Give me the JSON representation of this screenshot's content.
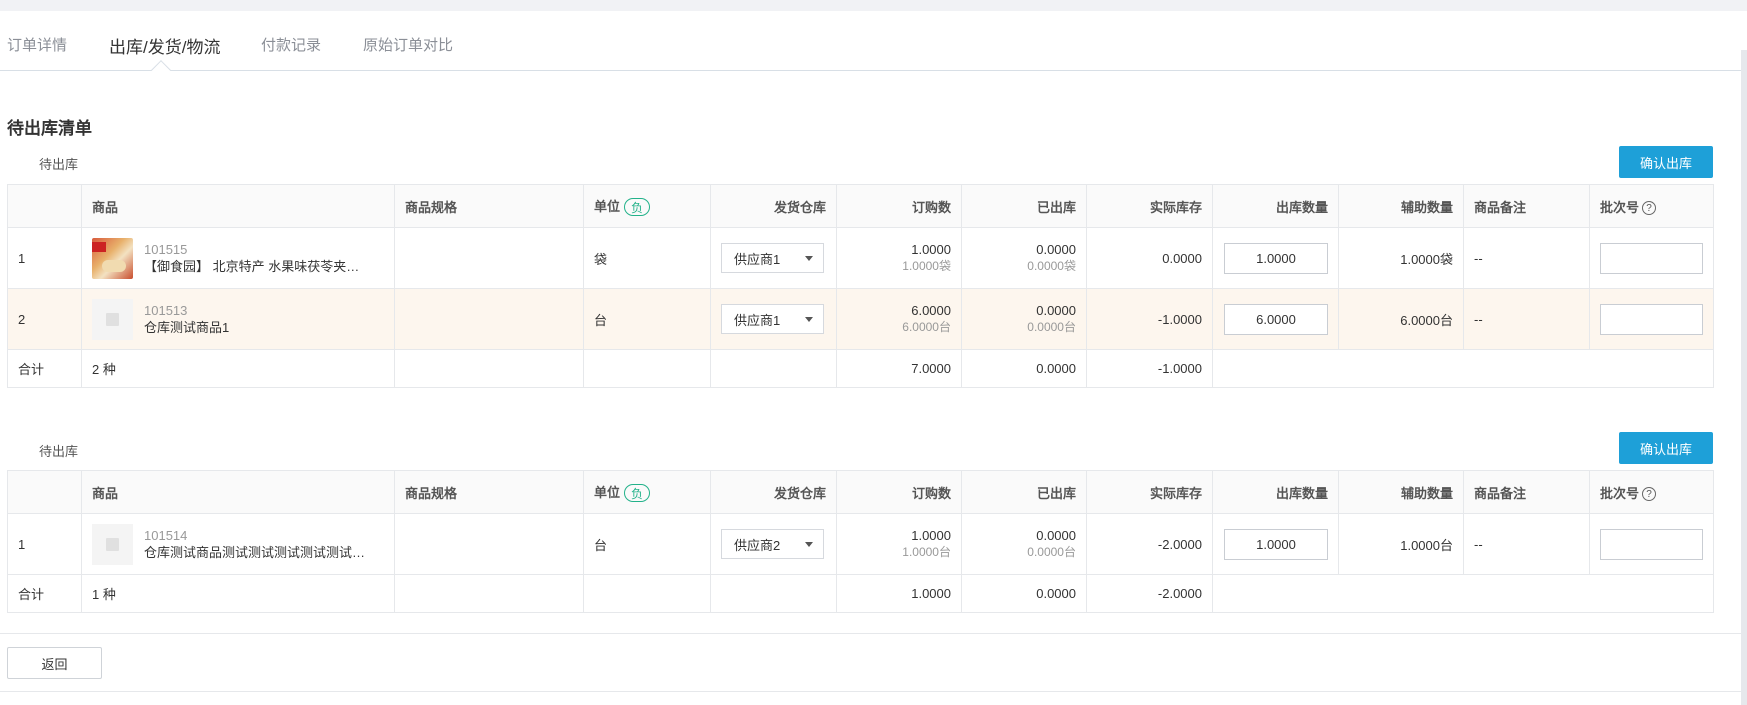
{
  "tabs": [
    {
      "label": "订单详情"
    },
    {
      "label": "出库/发货/物流"
    },
    {
      "label": "付款记录"
    },
    {
      "label": "原始订单对比"
    }
  ],
  "section_title": "待出库清单",
  "blocks": [
    {
      "label": "待出库",
      "confirm_label": "确认出库",
      "headers": {
        "product": "商品",
        "spec": "商品规格",
        "unit": "单位",
        "unit_badge": "负",
        "warehouse": "发货仓库",
        "ordered": "订购数",
        "shipped": "已出库",
        "stock": "实际库存",
        "out_qty": "出库数量",
        "aux_qty": "辅助数量",
        "remark": "商品备注",
        "batch": "批次号",
        "batch_help": "?"
      },
      "rows": [
        {
          "no": "1",
          "code": "101515",
          "name": "【御食园】 北京特产 水果味茯苓夹…",
          "spec": "",
          "unit": "袋",
          "warehouse": "供应商1",
          "ordered": "1.0000",
          "ordered_sub": "1.0000袋",
          "shipped": "0.0000",
          "shipped_sub": "0.0000袋",
          "stock": "0.0000",
          "out_qty": "1.0000",
          "aux_qty": "1.0000袋",
          "remark": "--",
          "batch": ""
        },
        {
          "no": "2",
          "code": "101513",
          "name": "仓库测试商品1",
          "spec": "",
          "unit": "台",
          "warehouse": "供应商1",
          "ordered": "6.0000",
          "ordered_sub": "6.0000台",
          "shipped": "0.0000",
          "shipped_sub": "0.0000台",
          "stock": "-1.0000",
          "out_qty": "6.0000",
          "aux_qty": "6.0000台",
          "remark": "--",
          "batch": ""
        }
      ],
      "total": {
        "label": "合计",
        "kinds": "2 种",
        "ordered": "7.0000",
        "shipped": "0.0000",
        "stock": "-1.0000"
      }
    },
    {
      "label": "待出库",
      "confirm_label": "确认出库",
      "headers": {
        "product": "商品",
        "spec": "商品规格",
        "unit": "单位",
        "unit_badge": "负",
        "warehouse": "发货仓库",
        "ordered": "订购数",
        "shipped": "已出库",
        "stock": "实际库存",
        "out_qty": "出库数量",
        "aux_qty": "辅助数量",
        "remark": "商品备注",
        "batch": "批次号",
        "batch_help": "?"
      },
      "rows": [
        {
          "no": "1",
          "code": "101514",
          "name": "仓库测试商品测试测试测试测试测试…",
          "spec": "",
          "unit": "台",
          "warehouse": "供应商2",
          "ordered": "1.0000",
          "ordered_sub": "1.0000台",
          "shipped": "0.0000",
          "shipped_sub": "0.0000台",
          "stock": "-2.0000",
          "out_qty": "1.0000",
          "aux_qty": "1.0000台",
          "remark": "--",
          "batch": ""
        }
      ],
      "total": {
        "label": "合计",
        "kinds": "1 种",
        "ordered": "1.0000",
        "shipped": "0.0000",
        "stock": "-2.0000"
      }
    }
  ],
  "back_label": "返回"
}
